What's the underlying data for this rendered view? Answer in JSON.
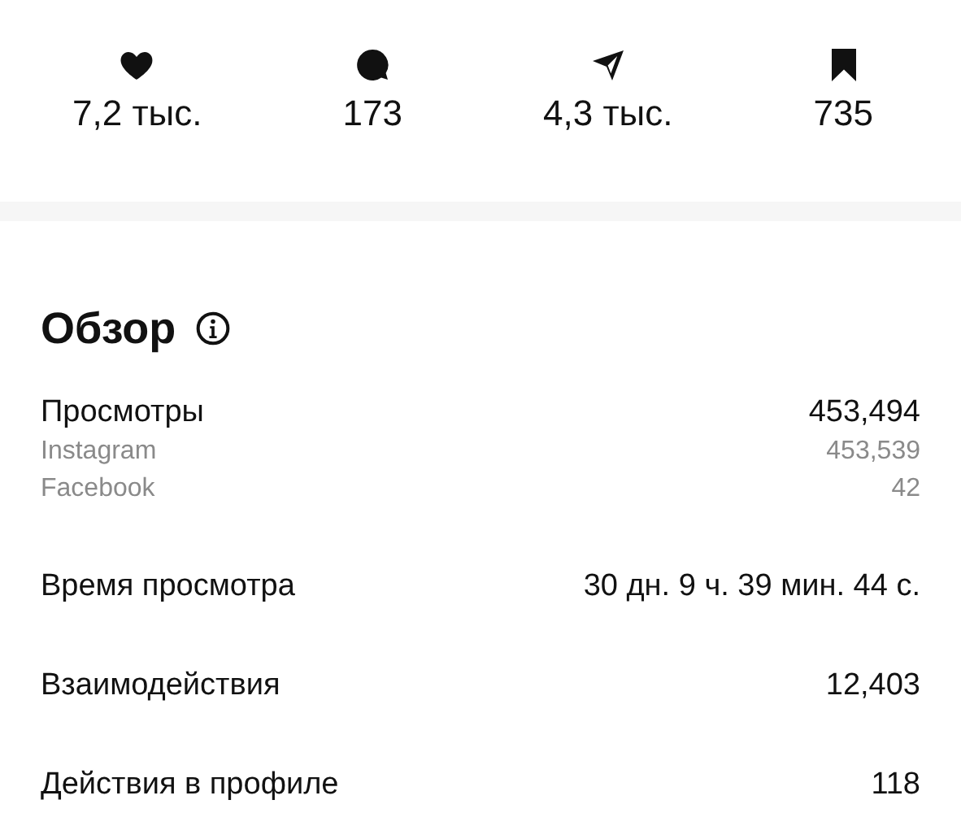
{
  "stats": [
    {
      "kind": "likes",
      "value": "7,2 тыс."
    },
    {
      "kind": "comments",
      "value": "173"
    },
    {
      "kind": "shares",
      "value": "4,3 тыс."
    },
    {
      "kind": "saves",
      "value": "735"
    }
  ],
  "overview": {
    "title": "Обзор",
    "metrics": [
      {
        "label": "Просмотры",
        "value": "453,494",
        "breakdown": [
          {
            "label": "Instagram",
            "value": "453,539"
          },
          {
            "label": "Facebook",
            "value": "42"
          }
        ]
      },
      {
        "label": "Время просмотра",
        "value": "30 дн. 9 ч. 39 мин. 44 с."
      },
      {
        "label": "Взаимодействия",
        "value": "12,403"
      },
      {
        "label": "Действия в профиле",
        "value": "118"
      }
    ]
  }
}
